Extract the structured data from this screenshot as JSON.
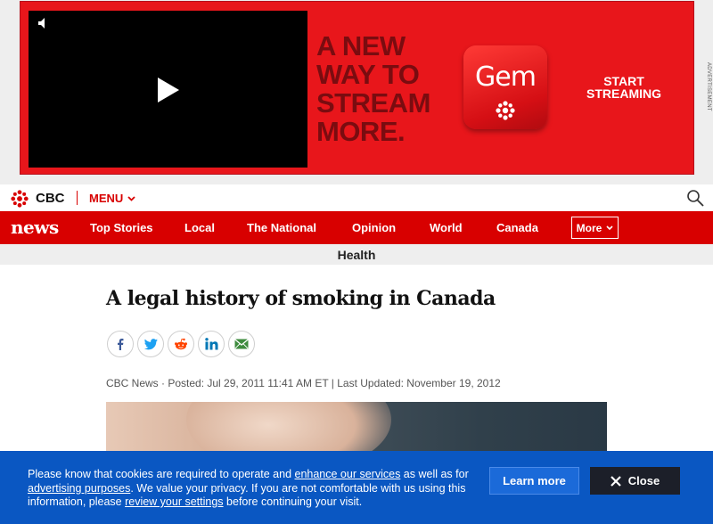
{
  "ad": {
    "headline": "A NEW\nWAY TO\nSTREAM\nMORE.",
    "brand": "Gem",
    "cta": "START\nSTREAMING",
    "label": "ADVERTISEMENT",
    "background_color": "#e8161b"
  },
  "header": {
    "brand": "CBC",
    "menu_label": "MENU"
  },
  "nav": {
    "logo": "news",
    "items": [
      "Top Stories",
      "Local",
      "The National",
      "Opinion",
      "World",
      "Canada"
    ],
    "more_label": "More",
    "background_color": "#d80000"
  },
  "section": {
    "label": "Health"
  },
  "article": {
    "title": "A legal history of smoking in Canada",
    "byline": "CBC News · Posted: Jul 29, 2011 11:41 AM ET | Last Updated: November 19, 2012",
    "share_icons": [
      "facebook-icon",
      "twitter-icon",
      "reddit-icon",
      "linkedin-icon",
      "email-icon"
    ]
  },
  "cookie": {
    "text_1": "Please know that cookies are required to operate and ",
    "link_1": "enhance our services",
    "text_2": " as well as for ",
    "link_2": "advertising purposes",
    "text_3": ". We value your privacy. If you are not comfortable with us using this information, please ",
    "link_3": "review your settings",
    "text_4": " before continuing your visit.",
    "learn_more_label": "Learn more",
    "close_label": "Close",
    "background_color": "#0a57c2"
  }
}
